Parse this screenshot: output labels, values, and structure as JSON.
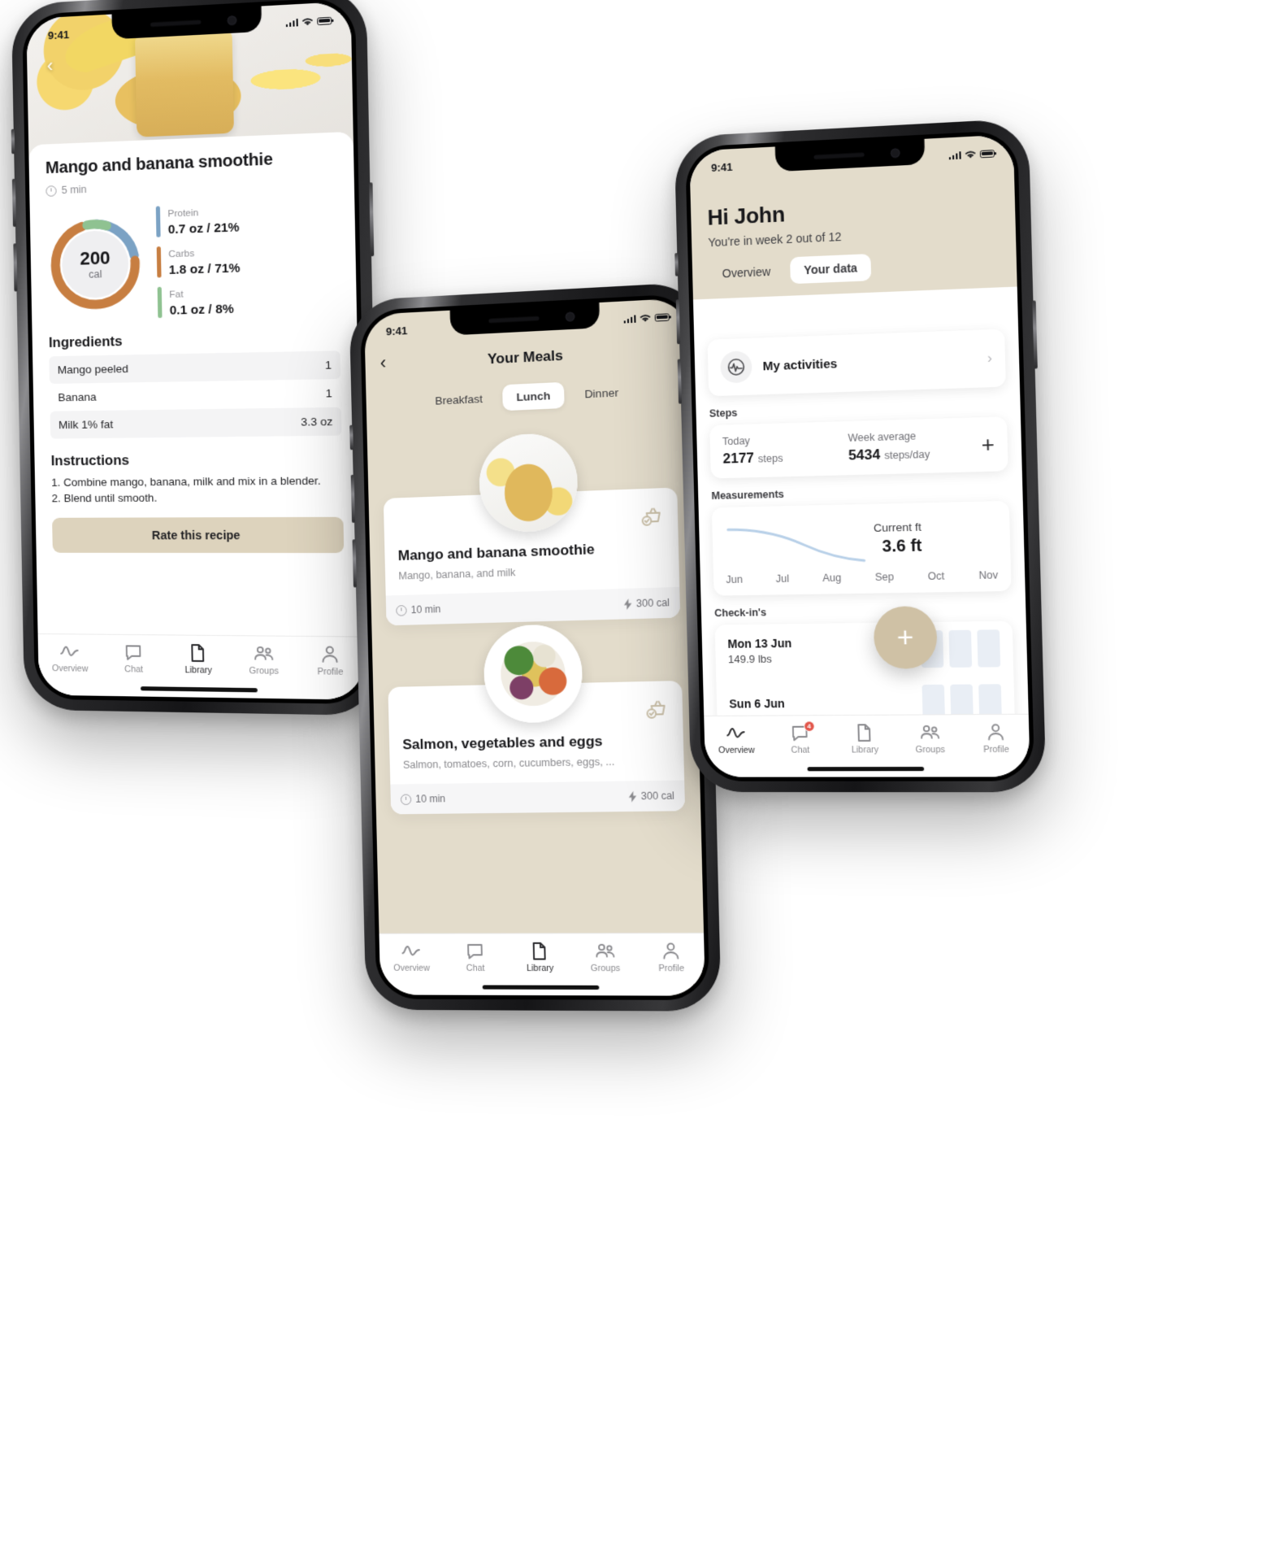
{
  "phone1": {
    "status": {
      "time": "9:41"
    },
    "back_icon": "chevron-left-icon",
    "recipe": {
      "title": "Mango and banana smoothie",
      "time": "5 min",
      "calories_value": "200",
      "calories_unit": "cal",
      "macros": [
        {
          "name": "Protein",
          "value": "0.7 oz / 21%",
          "percent": 21,
          "color": "#7ba2c4"
        },
        {
          "name": "Carbs",
          "value": "1.8 oz / 71%",
          "percent": 71,
          "color": "#c77e41"
        },
        {
          "name": "Fat",
          "value": "0.1 oz / 8%",
          "percent": 8,
          "color": "#8fc291"
        }
      ],
      "ingredients_heading": "Ingredients",
      "ingredients": [
        {
          "name": "Mango peeled",
          "amount": "1"
        },
        {
          "name": "Banana",
          "amount": "1"
        },
        {
          "name": "Milk 1% fat",
          "amount": "3.3 oz"
        }
      ],
      "instructions_heading": "Instructions",
      "instructions": "1. Combine mango, banana, milk and mix in a blender.\n2. Blend until smooth.",
      "rate_button": "Rate this recipe"
    },
    "tabs": [
      {
        "label": "Overview",
        "icon": "activity-icon",
        "active": false
      },
      {
        "label": "Chat",
        "icon": "chat-icon",
        "active": false
      },
      {
        "label": "Library",
        "icon": "document-icon",
        "active": true
      },
      {
        "label": "Groups",
        "icon": "people-icon",
        "active": false
      },
      {
        "label": "Profile",
        "icon": "person-icon",
        "active": false
      }
    ]
  },
  "phone2": {
    "status": {
      "time": "9:41"
    },
    "back_icon": "chevron-left-icon",
    "title": "Your Meals",
    "segments": [
      {
        "label": "Breakfast",
        "active": false
      },
      {
        "label": "Lunch",
        "active": true
      },
      {
        "label": "Dinner",
        "active": false
      }
    ],
    "meals": [
      {
        "title": "Mango and banana smoothie",
        "subtitle": "Mango, banana, and milk",
        "time": "10 min",
        "calories": "300 cal",
        "cart_icon": "basket-check-icon",
        "thumb": "smoothie"
      },
      {
        "title": "Salmon, vegetables and eggs",
        "subtitle": "Salmon, tomatoes, corn, cucumbers, eggs, ...",
        "time": "10 min",
        "calories": "300 cal",
        "cart_icon": "basket-check-icon",
        "thumb": "salmon"
      }
    ],
    "tabs": [
      {
        "label": "Overview",
        "icon": "activity-icon",
        "active": false
      },
      {
        "label": "Chat",
        "icon": "chat-icon",
        "active": false
      },
      {
        "label": "Library",
        "icon": "document-icon",
        "active": true
      },
      {
        "label": "Groups",
        "icon": "people-icon",
        "active": false
      },
      {
        "label": "Profile",
        "icon": "person-icon",
        "active": false
      }
    ]
  },
  "phone3": {
    "status": {
      "time": "9:41"
    },
    "greeting": "Hi John",
    "subtitle": "You're in week 2 out of 12",
    "tabs": [
      {
        "label": "Overview",
        "active": false
      },
      {
        "label": "Your data",
        "active": true
      }
    ],
    "activities": {
      "label": "My activities",
      "icon": "activity-icon",
      "chevron": "chevron-right-icon"
    },
    "steps": {
      "section_label": "Steps",
      "today_label": "Today",
      "today_value": "2177",
      "today_unit": "steps",
      "week_label": "Week average",
      "week_value": "5434",
      "week_unit": "steps/day",
      "add_icon": "plus-icon"
    },
    "measurements": {
      "section_label": "Measurements",
      "current_label": "Current ft",
      "current_value": "3.6 ft",
      "months": [
        "Jun",
        "Jul",
        "Aug",
        "Sep",
        "Oct",
        "Nov"
      ],
      "line_color": "#b8d0e8"
    },
    "checkins": {
      "section_label": "Check-in's",
      "rows": [
        {
          "date": "Mon 13 Jun",
          "weight": "149.9 lbs"
        },
        {
          "date": "Sun 6 Jun",
          "weight": ""
        }
      ]
    },
    "fab_icon": "plus-icon",
    "tabs_bottom": [
      {
        "label": "Overview",
        "icon": "activity-icon",
        "active": true,
        "badge": ""
      },
      {
        "label": "Chat",
        "icon": "chat-icon",
        "active": false,
        "badge": "4"
      },
      {
        "label": "Library",
        "icon": "document-icon",
        "active": false,
        "badge": ""
      },
      {
        "label": "Groups",
        "icon": "people-icon",
        "active": false,
        "badge": ""
      },
      {
        "label": "Profile",
        "icon": "person-icon",
        "active": false,
        "badge": ""
      }
    ]
  },
  "chart_data": [
    {
      "type": "pie",
      "title": "Macronutrient breakdown",
      "categories": [
        "Protein",
        "Carbs",
        "Fat"
      ],
      "values": [
        21,
        71,
        8
      ],
      "colors": [
        "#7ba2c4",
        "#c77e41",
        "#8fc291"
      ],
      "center_label": "200 cal"
    },
    {
      "type": "line",
      "title": "Measurements",
      "x": [
        "Jun",
        "Jul",
        "Aug",
        "Sep",
        "Oct",
        "Nov"
      ],
      "values": [
        4.3,
        4.25,
        4.1,
        3.9,
        3.75,
        3.6
      ],
      "ylabel": "ft",
      "current": 3.6,
      "grid": false
    },
    {
      "type": "bar",
      "title": "Check-in's",
      "categories": [
        "Mon 13 Jun",
        "Sun 6 Jun"
      ],
      "values": [
        149.9,
        0
      ],
      "ylabel": "lbs"
    }
  ]
}
